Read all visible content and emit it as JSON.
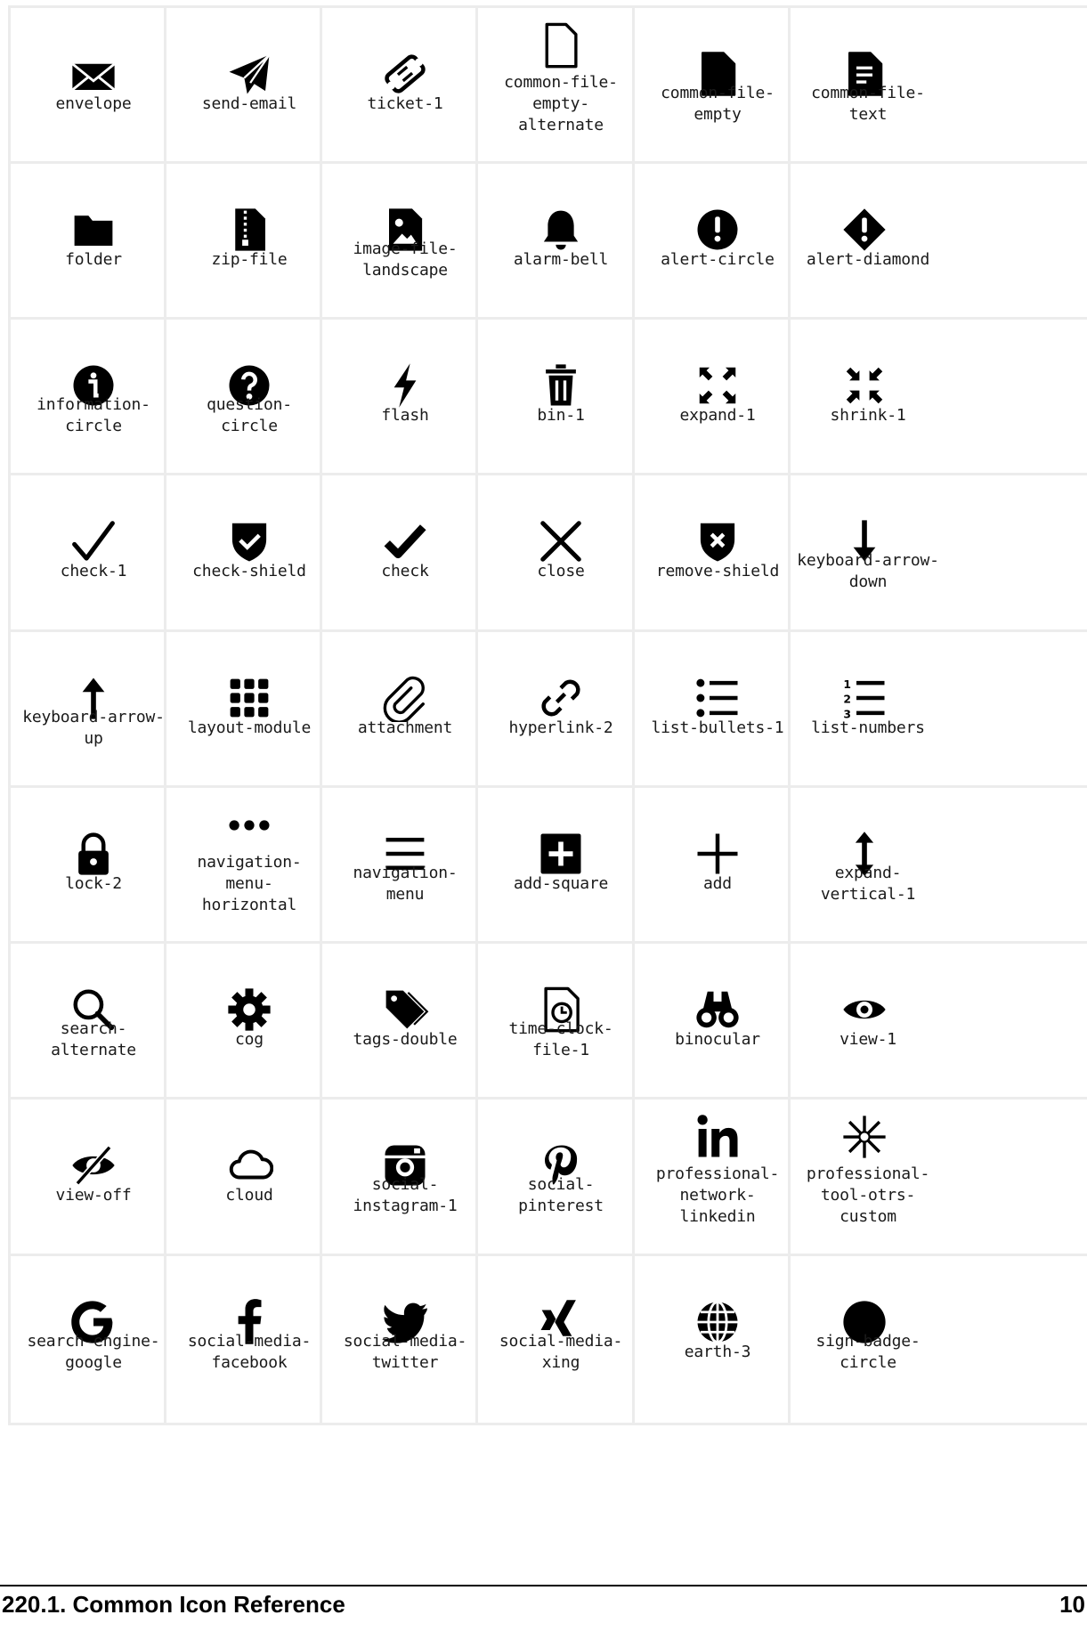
{
  "icons": [
    {
      "name": "envelope",
      "label": "envelope"
    },
    {
      "name": "send-email",
      "label": "send-email"
    },
    {
      "name": "ticket-1",
      "label": "ticket-1"
    },
    {
      "name": "common-file-empty-alternate",
      "label": "common-file-\nempty-\nalternate"
    },
    {
      "name": "common-file-empty",
      "label": "common-file-\nempty"
    },
    {
      "name": "common-file-text",
      "label": "common-file-\ntext"
    },
    {
      "name": "folder",
      "label": "folder"
    },
    {
      "name": "zip-file",
      "label": "zip-file"
    },
    {
      "name": "image-file-landscape",
      "label": "image-file-\nlandscape"
    },
    {
      "name": "alarm-bell",
      "label": "alarm-bell"
    },
    {
      "name": "alert-circle",
      "label": "alert-circle"
    },
    {
      "name": "alert-diamond",
      "label": "alert-diamond"
    },
    {
      "name": "information-circle",
      "label": "information-\ncircle"
    },
    {
      "name": "question-circle",
      "label": "question-\ncircle"
    },
    {
      "name": "flash",
      "label": "flash"
    },
    {
      "name": "bin-1",
      "label": "bin-1"
    },
    {
      "name": "expand-1",
      "label": "expand-1"
    },
    {
      "name": "shrink-1",
      "label": "shrink-1"
    },
    {
      "name": "check-1",
      "label": "check-1"
    },
    {
      "name": "check-shield",
      "label": "check-shield"
    },
    {
      "name": "check",
      "label": "check"
    },
    {
      "name": "close",
      "label": "close"
    },
    {
      "name": "remove-shield",
      "label": "remove-shield"
    },
    {
      "name": "keyboard-arrow-down",
      "label": "keyboard-arrow-\ndown"
    },
    {
      "name": "keyboard-arrow-up",
      "label": "keyboard-arrow-\nup"
    },
    {
      "name": "layout-module",
      "label": "layout-module"
    },
    {
      "name": "attachment",
      "label": "attachment"
    },
    {
      "name": "hyperlink-2",
      "label": "hyperlink-2"
    },
    {
      "name": "list-bullets-1",
      "label": "list-bullets-1"
    },
    {
      "name": "list-numbers",
      "label": "list-numbers"
    },
    {
      "name": "lock-2",
      "label": "lock-2"
    },
    {
      "name": "navigation-menu-horizontal",
      "label": "navigation-\nmenu-\nhorizontal"
    },
    {
      "name": "navigation-menu",
      "label": "navigation-\nmenu"
    },
    {
      "name": "add-square",
      "label": "add-square"
    },
    {
      "name": "add",
      "label": "add"
    },
    {
      "name": "expand-vertical-1",
      "label": "expand-\nvertical-1"
    },
    {
      "name": "search-alternate",
      "label": "search-\nalternate"
    },
    {
      "name": "cog",
      "label": "cog"
    },
    {
      "name": "tags-double",
      "label": "tags-double"
    },
    {
      "name": "time-clock-file-1",
      "label": "time-clock-\nfile-1"
    },
    {
      "name": "binocular",
      "label": "binocular"
    },
    {
      "name": "view-1",
      "label": "view-1"
    },
    {
      "name": "view-off",
      "label": "view-off"
    },
    {
      "name": "cloud",
      "label": "cloud"
    },
    {
      "name": "social-instagram-1",
      "label": "social-\ninstagram-1"
    },
    {
      "name": "social-pinterest",
      "label": "social-\npinterest"
    },
    {
      "name": "professional-network-linkedin",
      "label": "professional-\nnetwork-\nlinkedin"
    },
    {
      "name": "professional-tool-otrs-custom",
      "label": "professional-\ntool-otrs-\ncustom"
    },
    {
      "name": "search-engine-google",
      "label": "search-engine-\ngoogle"
    },
    {
      "name": "social-media-facebook",
      "label": "social-media-\nfacebook"
    },
    {
      "name": "social-media-twitter",
      "label": "social-media-\ntwitter"
    },
    {
      "name": "social-media-xing",
      "label": "social-media-\nxing"
    },
    {
      "name": "earth-3",
      "label": "earth-3"
    },
    {
      "name": "sign-badge-circle",
      "label": "sign-badge-\ncircle"
    }
  ],
  "footer": {
    "section_title": "220.1.  Common Icon Reference",
    "page_number": "10"
  }
}
